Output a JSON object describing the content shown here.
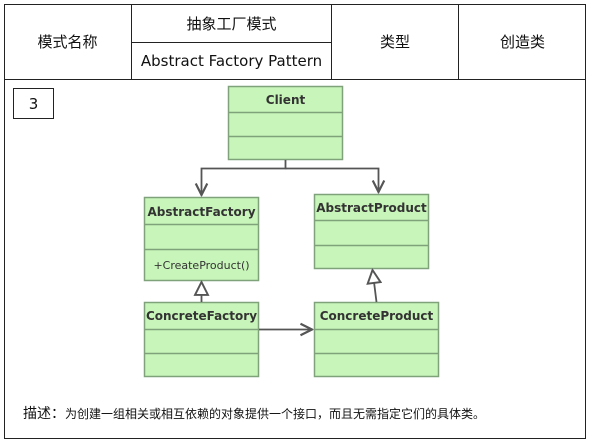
{
  "header": {
    "mode_name_label": "模式名称",
    "pattern_name_cn": "抽象工厂模式",
    "pattern_name_en": "Abstract Factory Pattern",
    "type_label": "类型",
    "type_value": "创造类"
  },
  "figure_number": "3",
  "diagram": {
    "classes": {
      "client": {
        "name": "Client",
        "method": ""
      },
      "abstract_factory": {
        "name": "AbstractFactory",
        "method": "+CreateProduct()"
      },
      "abstract_product": {
        "name": "AbstractProduct",
        "method": ""
      },
      "concrete_factory": {
        "name": "ConcreteFactory",
        "method": ""
      },
      "concrete_product": {
        "name": "ConcreteProduct",
        "method": ""
      }
    },
    "colors": {
      "box_fill": "#c8f5b9",
      "box_stroke": "#7fa27a",
      "line": "#555555",
      "text": "#333333"
    }
  },
  "description": {
    "label": "描述：",
    "text": "为创建一组相关或相互依赖的对象提供一个接口，而且无需指定它们的具体类。"
  }
}
